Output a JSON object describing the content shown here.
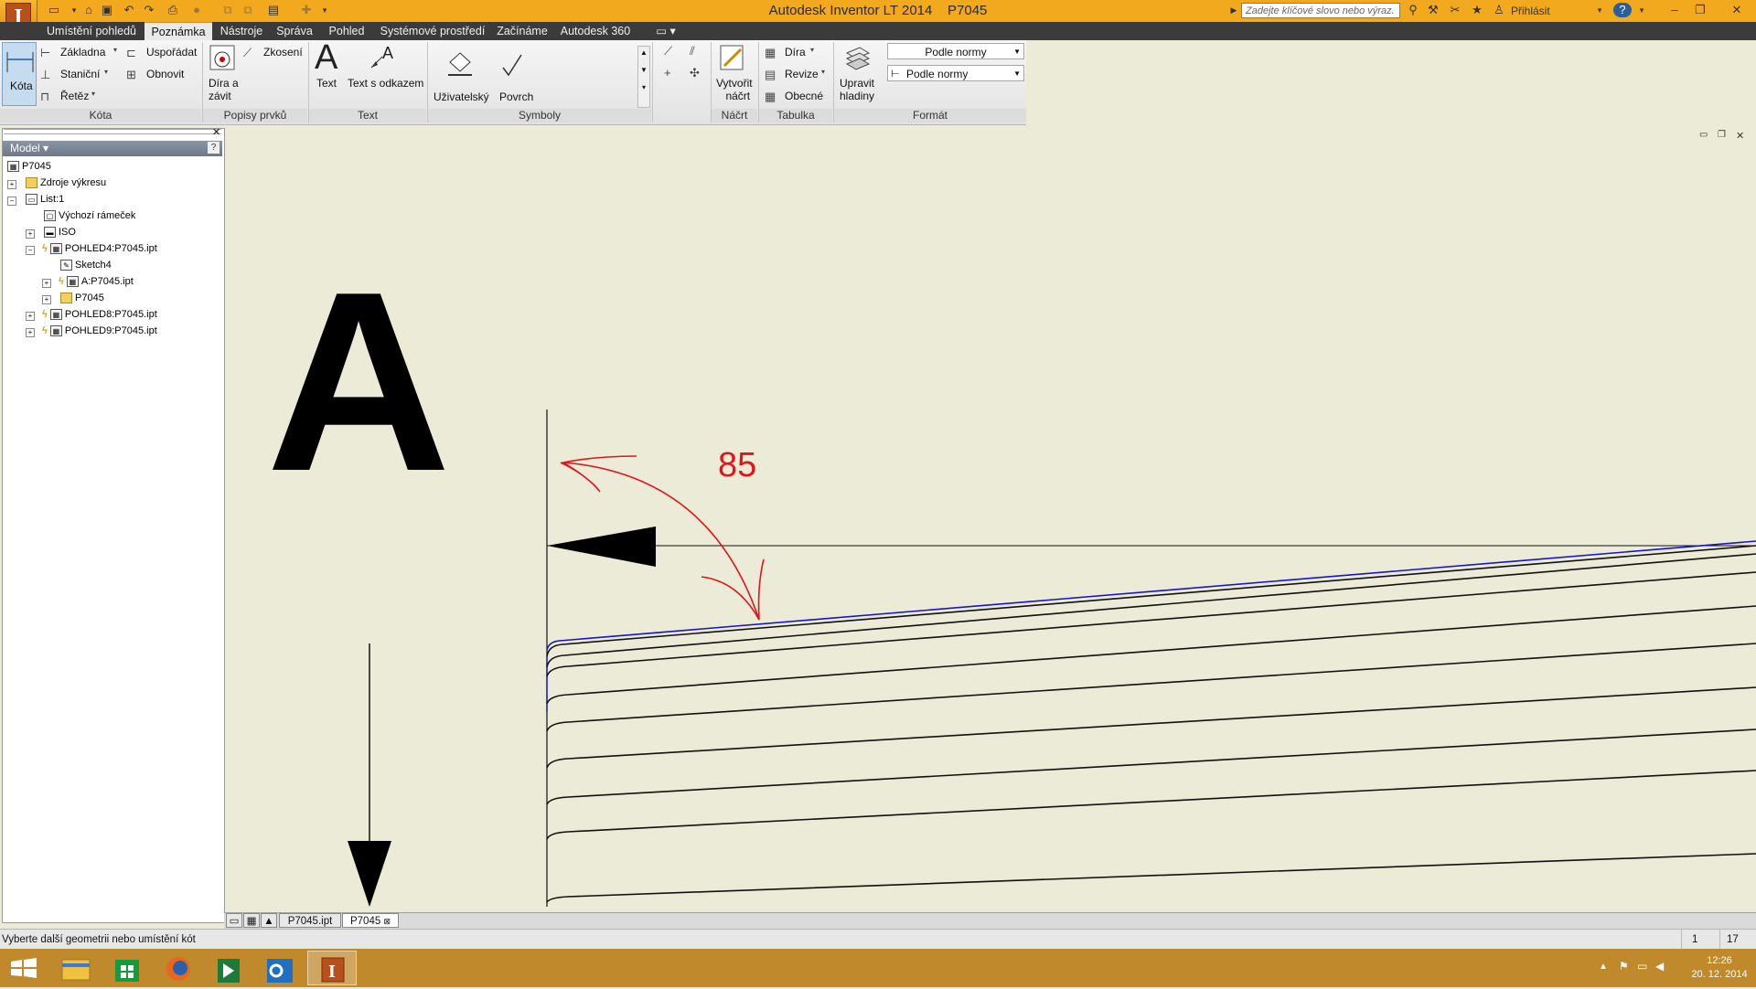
{
  "window": {
    "title": "Autodesk Inventor LT 2014",
    "document": "P7045"
  },
  "search": {
    "placeholder": "Zadejte klíčové slovo nebo výraz."
  },
  "account": {
    "signin": "Přihlásit"
  },
  "tabs": [
    "Umístění pohledů",
    "Poznámka",
    "Nástroje",
    "Správa",
    "Pohled",
    "Systémové prostředí",
    "Začínáme",
    "Autodesk 360"
  ],
  "ribbon": {
    "kota": {
      "title": "Kóta",
      "big": "Kóta",
      "zakladna": "Základna",
      "usporadat": "Uspořádat",
      "stanicni": "Staniční",
      "obnovit": "Obnovit",
      "retez": "Řetěz"
    },
    "popisy": {
      "title": "Popisy prvků",
      "dira_line1": "Díra a",
      "dira_line2": "závit",
      "zkoseni": "Zkosení"
    },
    "text": {
      "title": "Text",
      "text": "Text",
      "text_odkaz": "Text s odkazem"
    },
    "symboly": {
      "title": "Symboly",
      "uzivatelsky": "Uživatelský",
      "povrch": "Povrch"
    },
    "nacrt": {
      "title": "Náčrt",
      "line1": "Vytvořit",
      "line2": "náčrt"
    },
    "tabulka": {
      "title": "Tabulka",
      "dira": "Díra",
      "revize": "Revize",
      "obecne": "Obecné"
    },
    "format": {
      "title": "Formát",
      "upravit1": "Upravit",
      "upravit2": "hladiny",
      "style1": "Podle normy",
      "style2": "Podle normy"
    }
  },
  "browser": {
    "header": "Model",
    "items": [
      {
        "label": "P7045",
        "icon": "drawing-icon"
      },
      {
        "label": "Zdroje výkresu",
        "icon": "folder-icon"
      },
      {
        "label": "List:1",
        "icon": "sheet-icon"
      },
      {
        "label": "Výchozí rámeček",
        "icon": "border-icon"
      },
      {
        "label": "ISO",
        "icon": "titleblock-icon"
      },
      {
        "label": "POHLED4:P7045.ipt",
        "icon": "view-icon"
      },
      {
        "label": "Sketch4",
        "icon": "sketch-icon"
      },
      {
        "label": "A:P7045.ipt",
        "icon": "view-icon"
      },
      {
        "label": "P7045",
        "icon": "part-icon"
      },
      {
        "label": "POHLED8:P7045.ipt",
        "icon": "view-icon"
      },
      {
        "label": "POHLED9:P7045.ipt",
        "icon": "view-icon"
      }
    ]
  },
  "canvas": {
    "section_letter": "A",
    "annotation": "85",
    "annotation_color": "#e0161b",
    "highlight_color": "#1414d2"
  },
  "doc_tabs": [
    "P7045.ipt",
    "P7045"
  ],
  "status": {
    "message": "Vyberte další geometrii nebo umístění kót",
    "count1": "1",
    "count2": "17"
  },
  "taskbar": {
    "time": "12:26",
    "date": "20. 12. 2014"
  }
}
